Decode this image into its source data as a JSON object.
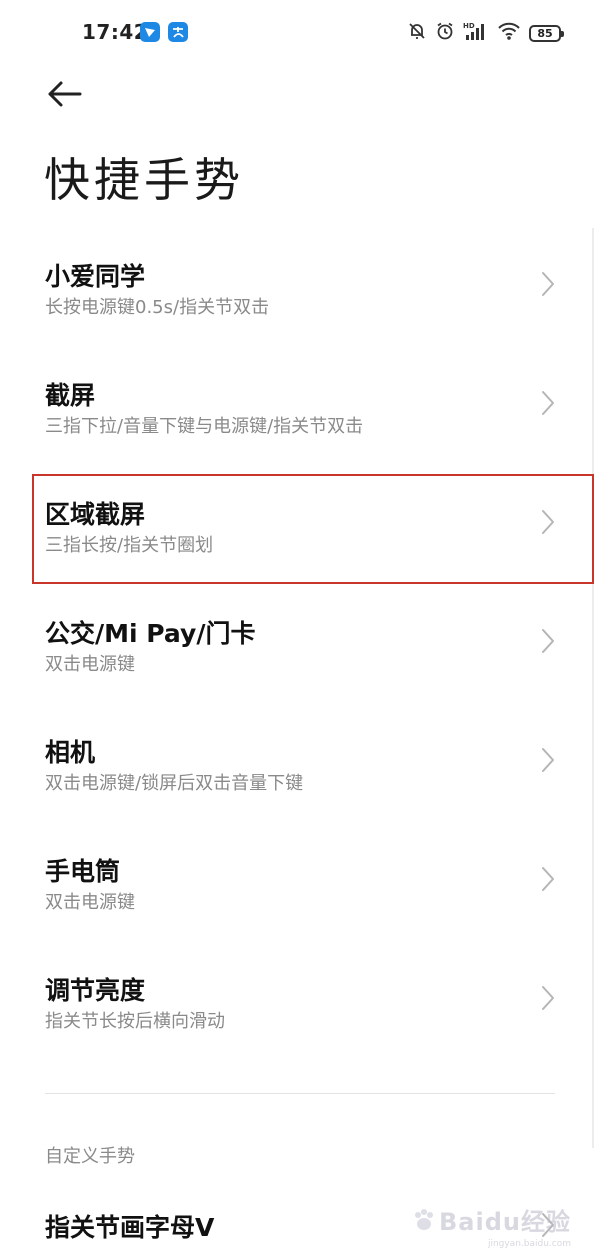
{
  "status_bar": {
    "time": "17:42",
    "battery": "85",
    "notification_icons": [
      "feishu-app-icon",
      "alipay-app-icon"
    ],
    "system_icons": [
      "bell-muted-icon",
      "alarm-icon",
      "hd-signal-icon",
      "wifi-icon",
      "battery-icon"
    ]
  },
  "header": {
    "title": "快捷手势"
  },
  "gestures": [
    {
      "title": "小爱同学",
      "subtitle": "长按电源键0.5s/指关节双击"
    },
    {
      "title": "截屏",
      "subtitle": "三指下拉/音量下键与电源键/指关节双击"
    },
    {
      "title": "区域截屏",
      "subtitle": "三指长按/指关节圈划"
    },
    {
      "title": "公交/Mi Pay/门卡",
      "subtitle": "双击电源键"
    },
    {
      "title": "相机",
      "subtitle": "双击电源键/锁屏后双击音量下键"
    },
    {
      "title": "手电筒",
      "subtitle": "双击电源键"
    },
    {
      "title": "调节亮度",
      "subtitle": "指关节长按后横向滑动"
    }
  ],
  "custom_section": {
    "header": "自定义手势",
    "items": [
      {
        "title": "指关节画字母V"
      }
    ]
  },
  "watermark": {
    "text": "Baidu经验",
    "sub": "jingyan.baidu.com"
  },
  "colors": {
    "highlight_border": "#c8352b",
    "subtitle_text": "#8a8a8a"
  }
}
